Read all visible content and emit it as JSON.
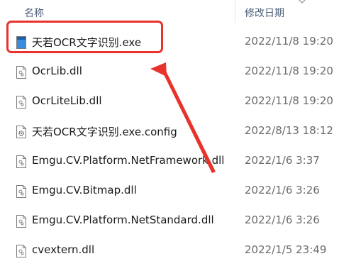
{
  "header": {
    "name_label": "名称",
    "date_label": "修改日期"
  },
  "files": [
    {
      "name": "天若OCR文字识别.exe",
      "date": "2022/11/8 19:20",
      "icon": "exe-icon"
    },
    {
      "name": "OcrLib.dll",
      "date": "2022/11/8 19:20",
      "icon": "dll-file-icon"
    },
    {
      "name": "OcrLiteLib.dll",
      "date": "2022/11/8 19:20",
      "icon": "dll-file-icon"
    },
    {
      "name": "天若OCR文字识别.exe.config",
      "date": "2022/8/13 18:12",
      "icon": "config-file-icon"
    },
    {
      "name": "Emgu.CV.Platform.NetFramework.dll",
      "date": "2022/1/6 3:37",
      "icon": "dll-file-icon"
    },
    {
      "name": "Emgu.CV.Bitmap.dll",
      "date": "2022/1/6 3:26",
      "icon": "dll-file-icon"
    },
    {
      "name": "Emgu.CV.Platform.NetStandard.dll",
      "date": "2022/1/6 3:26",
      "icon": "dll-file-icon"
    },
    {
      "name": "cvextern.dll",
      "date": "2022/1/5 23:49",
      "icon": "dll-file-icon"
    }
  ],
  "colors": {
    "highlight": "#e8332d",
    "header_text": "#4c607a",
    "date_text": "#6b6b6b"
  }
}
